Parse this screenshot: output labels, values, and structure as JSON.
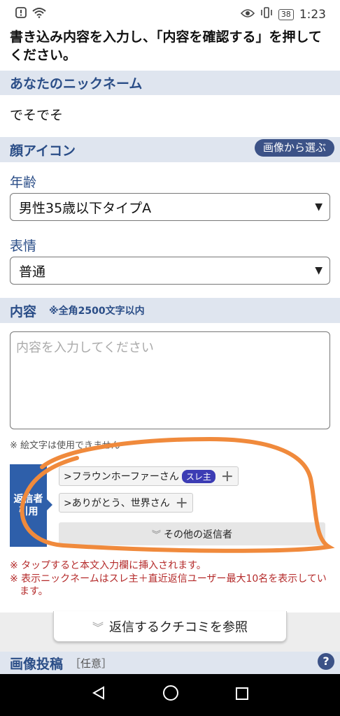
{
  "status": {
    "time": "1:23",
    "battery": "38"
  },
  "instruction": "書き込み内容を入力し、「内容を確認する」を押してください。",
  "nickname_section": {
    "title": "あなたのニックネーム",
    "value": "でそでそ"
  },
  "face_icon_section": {
    "title": "顔アイコン",
    "choose_image_button": "画像から選ぶ",
    "age_label": "年齢",
    "age_value": "男性35歳以下タイプA",
    "expression_label": "表情",
    "expression_value": "普通"
  },
  "content_section": {
    "title": "内容",
    "limit_note": "※全角2500文字以内",
    "placeholder": "内容を入力してください",
    "emoji_note": "※ 絵文字は使用できません"
  },
  "reply": {
    "label_line1": "返信者",
    "label_line2": "引用",
    "chips": [
      {
        "name": ">フラウンホーファーさん",
        "badge": "スレ主"
      },
      {
        "name": ">ありがとう、世界さん",
        "badge": ""
      }
    ],
    "others_button": "その他の返信者",
    "notes": [
      "※ タップすると本文入力欄に挿入されます。",
      "※ 表示ニックネームはスレ主＋直近返信ユーザー最大10名を表示しています。"
    ]
  },
  "reference_button": "返信するクチコミを参照",
  "image_post": {
    "title": "画像投稿",
    "optional": "［任意］"
  },
  "colors": {
    "section_bg": "#dfe5ef",
    "section_text": "#2a4d87",
    "reply_label_bg": "#2e5faa",
    "annotation": "#f08a3c"
  }
}
